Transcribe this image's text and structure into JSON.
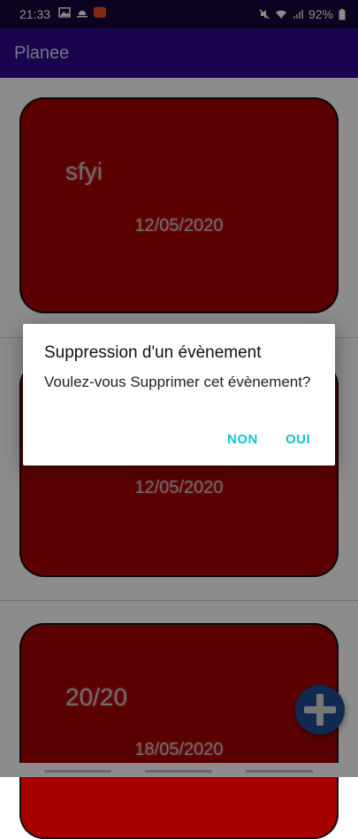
{
  "status_bar": {
    "time": "21:33",
    "battery": "92%",
    "left_icons": [
      "image-icon",
      "weather-icon",
      "app-notification-icon"
    ],
    "right_icons": [
      "mute-icon",
      "wifi-icon",
      "signal-icon",
      "battery-icon"
    ]
  },
  "app_bar": {
    "title": "Planee"
  },
  "events": [
    {
      "name": "sfyi",
      "date": "12/05/2020"
    },
    {
      "name": "",
      "date": "12/05/2020"
    },
    {
      "name": "20/20",
      "date": "18/05/2020"
    }
  ],
  "dialog": {
    "title": "Suppression d'un évènement",
    "message": "Voulez-vous Supprimer cet évènement?",
    "negative": "NON",
    "positive": "OUI"
  },
  "fab": {
    "icon": "plus-icon"
  },
  "colors": {
    "app_bar": "#2f0a8e",
    "card": "#a70000",
    "accent": "#12c4cf",
    "fab": "#1f4d95"
  }
}
